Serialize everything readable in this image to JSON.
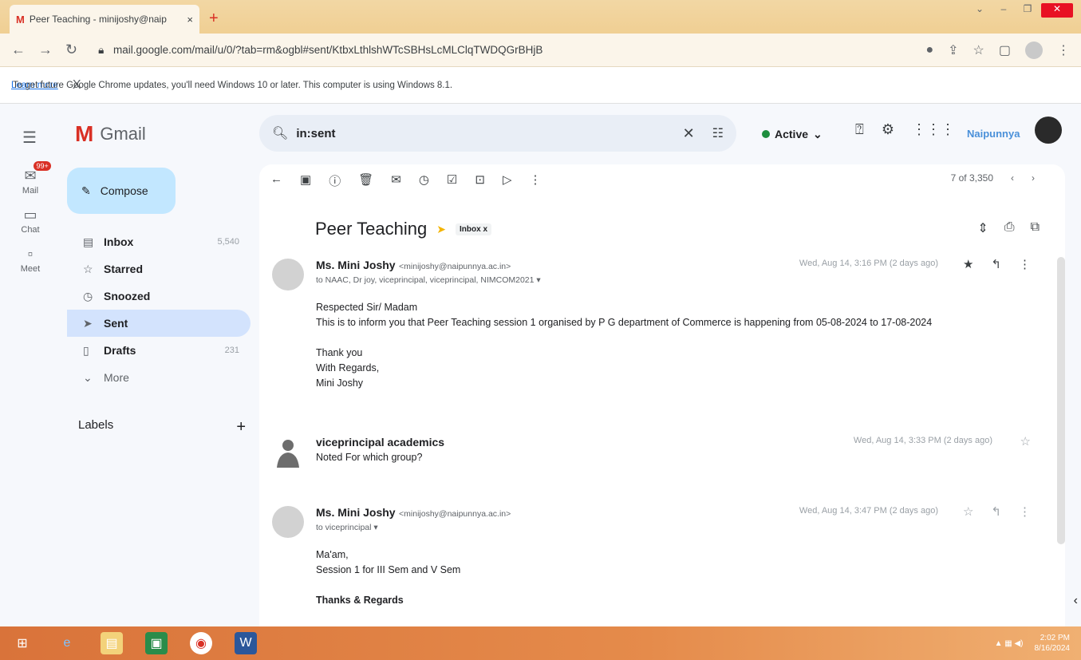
{
  "browser": {
    "tab_title": "Peer Teaching - minijoshy@naip",
    "tab_favicon": "M",
    "tab_close": "×",
    "new_tab": "+",
    "url": "mail.google.com/mail/u/0/?tab=rm&ogbl#sent/KtbxLthlshWTcSBHsLcMLClqTWDQGrBHjB",
    "info_message": "To get future Google Chrome updates, you'll need Windows 10 or later. This computer is using Windows 8.1.",
    "learn_more": "Learn more",
    "info_close": "X"
  },
  "gmail": {
    "app_name": "Gmail",
    "search_value": "in:sent",
    "status": "Active",
    "org_brand": "Naipunnya",
    "rail": [
      {
        "label": "Mail",
        "badge": "99+"
      },
      {
        "label": "Chat"
      },
      {
        "label": "Meet"
      }
    ],
    "compose": "Compose",
    "folders": [
      {
        "label": "Inbox",
        "count": "5,540"
      },
      {
        "label": "Starred",
        "count": ""
      },
      {
        "label": "Snoozed",
        "count": ""
      },
      {
        "label": "Sent",
        "count": ""
      },
      {
        "label": "Drafts",
        "count": "231"
      },
      {
        "label": "More",
        "count": ""
      }
    ],
    "labels_heading": "Labels",
    "pager": "7 of 3,350"
  },
  "thread": {
    "subject": "Peer Teaching",
    "tag": "Inbox",
    "tag_close": "x",
    "messages": [
      {
        "from": "Ms. Mini Joshy",
        "email": "<minijoshy@naipunnya.ac.in>",
        "to": "to NAAC, Dr joy, viceprincipal, viceprincipal, NIMCOM2021 ▾",
        "date": "Wed, Aug 14, 3:16 PM (2 days ago)",
        "body": [
          "Respected Sir/ Madam",
          "This is to inform you that Peer Teaching session 1 organised by P G department of Commerce is happening from 05-08-2024 to 17-08-2024",
          "",
          "Thank you",
          "With Regards,",
          "Mini Joshy"
        ]
      },
      {
        "from": "viceprincipal academics",
        "snippet": "Noted For which group?",
        "date": "Wed, Aug 14, 3:33 PM (2 days ago)"
      },
      {
        "from": "Ms. Mini Joshy",
        "email": "<minijoshy@naipunnya.ac.in>",
        "to": "to viceprincipal ▾",
        "date": "Wed, Aug 14, 3:47 PM (2 days ago)",
        "body": [
          "Ma'am,",
          "Session 1 for III Sem and V Sem",
          "",
          "Thanks & Regards"
        ]
      }
    ]
  },
  "taskbar": {
    "clock_time": "2:02 PM",
    "clock_date": "8/16/2024"
  },
  "colors": {
    "accent": "#1a73e8",
    "gmail_red": "#d93025",
    "active_green": "#1e8e3e",
    "compose_bg": "#c2e7ff",
    "selected_folder": "#d3e3fd"
  }
}
